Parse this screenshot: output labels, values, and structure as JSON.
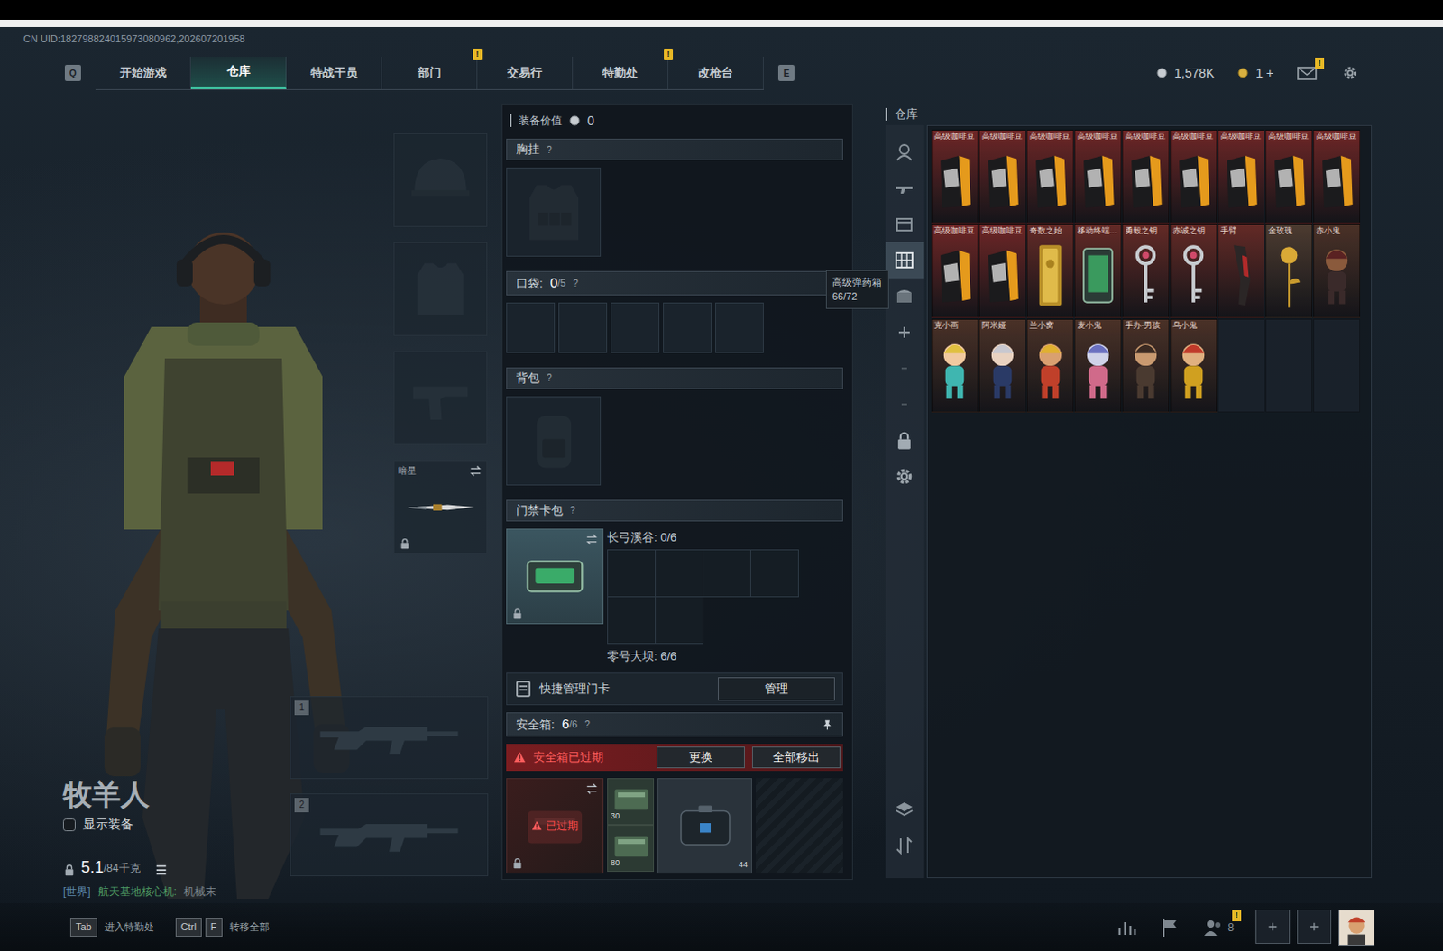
{
  "top": {
    "uid": "CN UID:182798824015973080962,202607201958"
  },
  "nav": {
    "prev_key": "Q",
    "next_key": "E",
    "tabs": [
      {
        "label": "开始游戏",
        "selected": false,
        "badge": ""
      },
      {
        "label": "仓库",
        "selected": true,
        "badge": ""
      },
      {
        "label": "特战干员",
        "selected": false,
        "badge": ""
      },
      {
        "label": "部门",
        "selected": false,
        "badge": "!"
      },
      {
        "label": "交易行",
        "selected": false,
        "badge": ""
      },
      {
        "label": "特勤处",
        "selected": false,
        "badge": "!"
      },
      {
        "label": "改枪台",
        "selected": false,
        "badge": ""
      }
    ]
  },
  "wallet": [
    {
      "kind": "silver",
      "amount": "1,578K"
    },
    {
      "kind": "gold",
      "amount": "1 +"
    }
  ],
  "mail": {
    "badge": "!"
  },
  "operator": {
    "name": "牧羊人",
    "show_equipment": {
      "label": "显示装备",
      "checked": false
    },
    "weight": "5.1",
    "capacity": "/84千克"
  },
  "chat": {
    "channel": "[世界]",
    "source": "航天基地核心机:",
    "text": "机械末"
  },
  "equipment": [
    {
      "kind": "helmet",
      "label": "",
      "locked": false,
      "swappable": false
    },
    {
      "kind": "armor",
      "label": "",
      "locked": false,
      "swappable": false
    },
    {
      "kind": "pistol",
      "label": "",
      "locked": false,
      "swappable": false
    },
    {
      "kind": "melee",
      "label": "暗星",
      "locked": true,
      "swappable": true
    }
  ],
  "weapons": [
    {
      "index": "1"
    },
    {
      "index": "2"
    }
  ],
  "loadout": {
    "value_label": "装备价值",
    "value": "0",
    "chest": {
      "label": "胸挂",
      "help": "?"
    },
    "pockets": {
      "label": "口袋:",
      "count": "0",
      "capacity": "/5",
      "help": "?",
      "slots": [
        {
          "filled": false
        },
        {
          "filled": false
        },
        {
          "filled": false
        },
        {
          "filled": false
        },
        {
          "filled": false
        }
      ]
    },
    "tooltip": {
      "title": "高级弹药箱",
      "value": "66/72"
    },
    "backpack": {
      "label": "背包",
      "help": "?"
    },
    "keycards": {
      "label": "门禁卡包",
      "help": "?",
      "locked": true,
      "swappable": true,
      "map": {
        "label": "长弓溪谷: 0/6",
        "slots": [
          {
            "filled": false
          },
          {
            "filled": false
          },
          {
            "filled": false
          },
          {
            "filled": false
          },
          {
            "filled": false
          },
          {
            "filled": false
          }
        ]
      },
      "footer": "零号大坝: 6/6"
    },
    "quick_manage": {
      "label": "快捷管理门卡",
      "button": "管理"
    },
    "safe": {
      "label": "安全箱:",
      "count": "6",
      "capacity": "/6",
      "help": "?",
      "pinned": true,
      "alert": "安全箱已过期",
      "buttons": [
        "更换",
        "全部移出"
      ],
      "case": {
        "label": "已过期",
        "locked": true,
        "swappable": true
      },
      "items": [
        {
          "kind": "ammo",
          "count": "30"
        },
        {
          "kind": "ammo",
          "count": "80"
        },
        {
          "kind": "case",
          "count": "44"
        }
      ]
    }
  },
  "warehouse": {
    "title": "仓库",
    "sidebar": {
      "top": [
        {
          "kind": "operator",
          "selected": false
        },
        {
          "kind": "weapon",
          "selected": false
        },
        {
          "kind": "box",
          "selected": false
        },
        {
          "kind": "grid",
          "selected": true
        },
        {
          "kind": "chest",
          "selected": false
        },
        {
          "kind": "plus",
          "selected": false
        },
        {
          "kind": "dash",
          "selected": false
        },
        {
          "kind": "dash",
          "selected": false
        },
        {
          "kind": "lock",
          "selected": false
        },
        {
          "kind": "gear",
          "selected": false
        }
      ],
      "bottom": [
        {
          "kind": "layers",
          "selected": false
        },
        {
          "kind": "sort",
          "selected": false
        }
      ]
    },
    "items": [
      {
        "label": "高级咖啡豆",
        "kind": "coffee",
        "color": "#6e2626"
      },
      {
        "label": "高级咖啡豆",
        "kind": "coffee",
        "color": "#6e2626"
      },
      {
        "label": "高级咖啡豆",
        "kind": "coffee",
        "color": "#6e2626"
      },
      {
        "label": "高级咖啡豆",
        "kind": "coffee",
        "color": "#6e2626"
      },
      {
        "label": "高级咖啡豆",
        "kind": "coffee",
        "color": "#6e2626"
      },
      {
        "label": "高级咖啡豆",
        "kind": "coffee",
        "color": "#6e2626"
      },
      {
        "label": "高级咖啡豆",
        "kind": "coffee",
        "color": "#6e2626"
      },
      {
        "label": "高级咖啡豆",
        "kind": "coffee",
        "color": "#6e2626"
      },
      {
        "label": "高级咖啡豆",
        "kind": "coffee",
        "color": "#6e2626"
      },
      {
        "label": "高级咖啡豆",
        "kind": "coffee",
        "color": "#6e2626"
      },
      {
        "label": "高级咖啡豆",
        "kind": "coffee",
        "color": "#6e2626"
      },
      {
        "label": "奇数之始",
        "kind": "gold",
        "color": "#632a26"
      },
      {
        "label": "移动终端...",
        "kind": "terminal",
        "color": "#632a26"
      },
      {
        "label": "勇毅之钥",
        "kind": "key",
        "color": "#632a26"
      },
      {
        "label": "赤诚之钥",
        "kind": "key",
        "color": "#632a26"
      },
      {
        "label": "手臂",
        "kind": "arm",
        "color": "#632a26"
      },
      {
        "label": "金玫瑰",
        "kind": "rose",
        "color": "#4c3b30"
      },
      {
        "label": "赤小鬼",
        "kind": "figure",
        "color": "#4a3127"
      },
      {
        "label": "克小画",
        "kind": "figure",
        "color": "#4a3127"
      },
      {
        "label": "阿米娅",
        "kind": "figure",
        "color": "#4a3127"
      },
      {
        "label": "兰小窝",
        "kind": "figure",
        "color": "#4a3127"
      },
      {
        "label": "麦小鬼",
        "kind": "figure",
        "color": "#4a3127"
      },
      {
        "label": "手办·男孩",
        "kind": "figure",
        "color": "#4a3127"
      },
      {
        "label": "乌小鬼",
        "kind": "figure",
        "color": "#4a3127"
      }
    ]
  },
  "hints": [
    {
      "keys": [
        "Tab"
      ],
      "label": "进入特勤处"
    },
    {
      "keys": [
        "Ctrl",
        "F"
      ],
      "label": "转移全部"
    }
  ],
  "social": {
    "friends": "8",
    "badge": "!"
  }
}
